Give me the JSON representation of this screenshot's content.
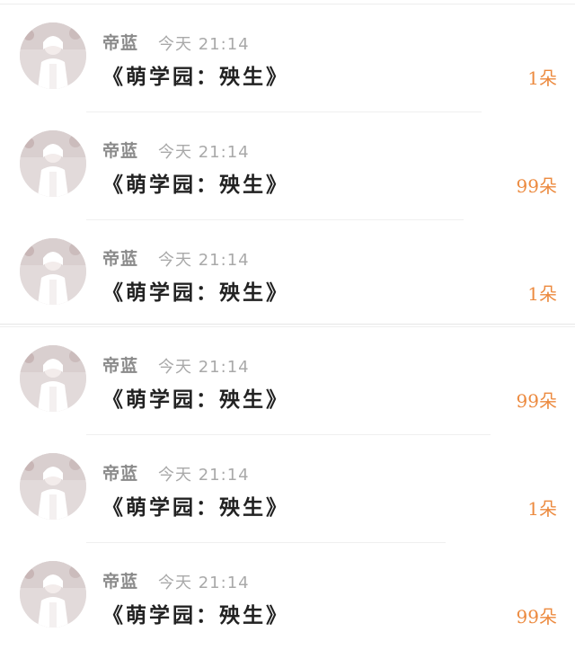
{
  "gifts": [
    {
      "name": "帝蓝",
      "time": "今天 21:14",
      "message": "《萌学园：殃生》",
      "amount": "1朵"
    },
    {
      "name": "帝蓝",
      "time": "今天 21:14",
      "message": "《萌学园：殃生》",
      "amount": "99朵"
    },
    {
      "name": "帝蓝",
      "time": "今天 21:14",
      "message": "《萌学园：殃生》",
      "amount": "1朵"
    },
    {
      "name": "帝蓝",
      "time": "今天 21:14",
      "message": "《萌学园：殃生》",
      "amount": "99朵"
    },
    {
      "name": "帝蓝",
      "time": "今天 21:14",
      "message": "《萌学园：殃生》",
      "amount": "1朵"
    },
    {
      "name": "帝蓝",
      "time": "今天 21:14",
      "message": "《萌学园：殃生》",
      "amount": "99朵"
    }
  ],
  "colors": {
    "amount": "#ec8a3f",
    "name": "#8a8a8a",
    "time": "#a9a9a9",
    "message": "#222222"
  },
  "icons": {
    "avatar": "user-avatar-photo"
  }
}
